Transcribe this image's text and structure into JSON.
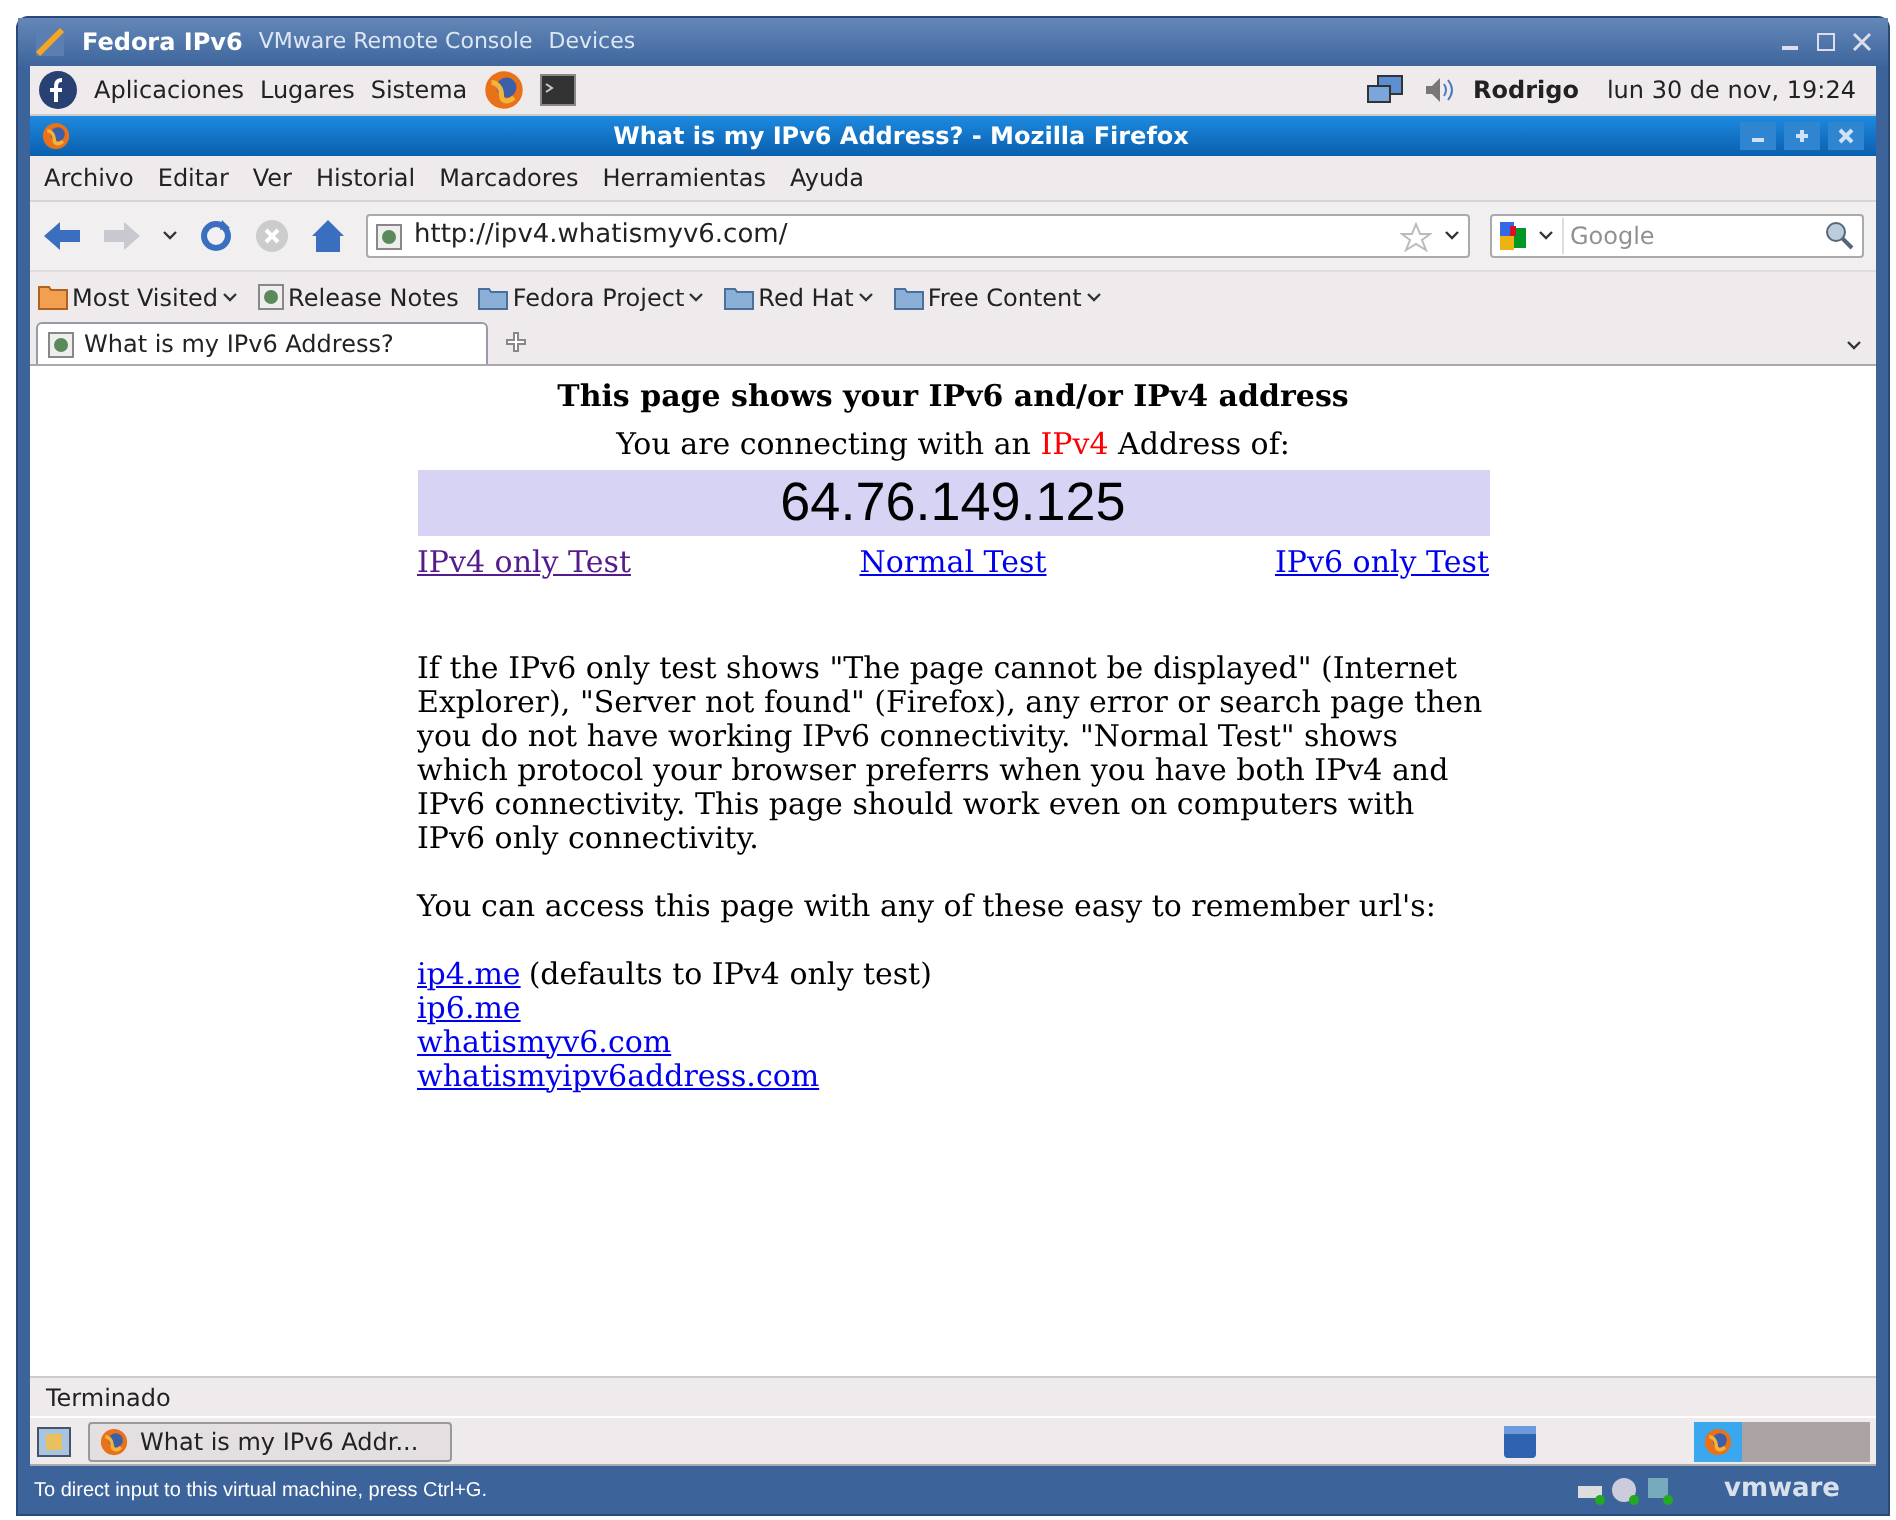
{
  "vm_window": {
    "title": "Fedora IPv6",
    "app_name": "VMware Remote Console",
    "devices_menu": "Devices"
  },
  "gnome_panel": {
    "menus": [
      "Aplicaciones",
      "Lugares",
      "Sistema"
    ],
    "user": "Rodrigo",
    "clock": "lun 30 de nov, 19:24"
  },
  "firefox": {
    "title": "What is my IPv6 Address? - Mozilla Firefox",
    "menu": [
      "Archivo",
      "Editar",
      "Ver",
      "Historial",
      "Marcadores",
      "Herramientas",
      "Ayuda"
    ],
    "url": "http://ipv4.whatismyv6.com/",
    "search_placeholder": "Google",
    "bookmarks": [
      {
        "label": "Most Visited",
        "kind": "smart",
        "dropdown": true
      },
      {
        "label": "Release Notes",
        "kind": "page",
        "dropdown": false
      },
      {
        "label": "Fedora Project",
        "kind": "folder",
        "dropdown": true
      },
      {
        "label": "Red Hat",
        "kind": "folder",
        "dropdown": true
      },
      {
        "label": "Free Content",
        "kind": "folder",
        "dropdown": true
      }
    ],
    "tabs": [
      {
        "label": "What is my IPv6 Address?",
        "selected": true
      }
    ],
    "status": "Terminado"
  },
  "page": {
    "heading": "This page shows your IPv6 and/or IPv4 address",
    "connecting": {
      "before": "You are connecting with an ",
      "protocol": "IPv4",
      "after": " Address of:"
    },
    "address": "64.76.149.125",
    "test_links": [
      {
        "label": "IPv4 only Test",
        "visited": true
      },
      {
        "label": "Normal Test",
        "visited": false
      },
      {
        "label": "IPv6 only Test",
        "visited": false
      }
    ],
    "paragraphs": [
      "If the IPv6 only test shows \"The page cannot be displayed\" (Internet Explorer), \"Server not found\" (Firefox), any error or search page then you do not have working IPv6 connectivity. \"Normal Test\" shows which protocol your browser preferrs when you have both IPv4 and IPv6 connectivity. This page should work even on computers with IPv6 only connectivity.",
      "You can access this page with any of these easy to remember url's:"
    ],
    "urls": [
      {
        "link": "ip4.me",
        "note": "(defaults to IPv4 only test)"
      },
      {
        "link": "ip6.me"
      },
      {
        "link": "whatismyv6.com"
      },
      {
        "link": "whatismyipv6address.com"
      }
    ]
  },
  "taskbar": {
    "windows": [
      {
        "label": "What is my IPv6 Addr...",
        "selected": false
      }
    ]
  },
  "vm_status": {
    "hint": "To direct input to this virtual machine, press Ctrl+G.",
    "brand": "vmware"
  }
}
